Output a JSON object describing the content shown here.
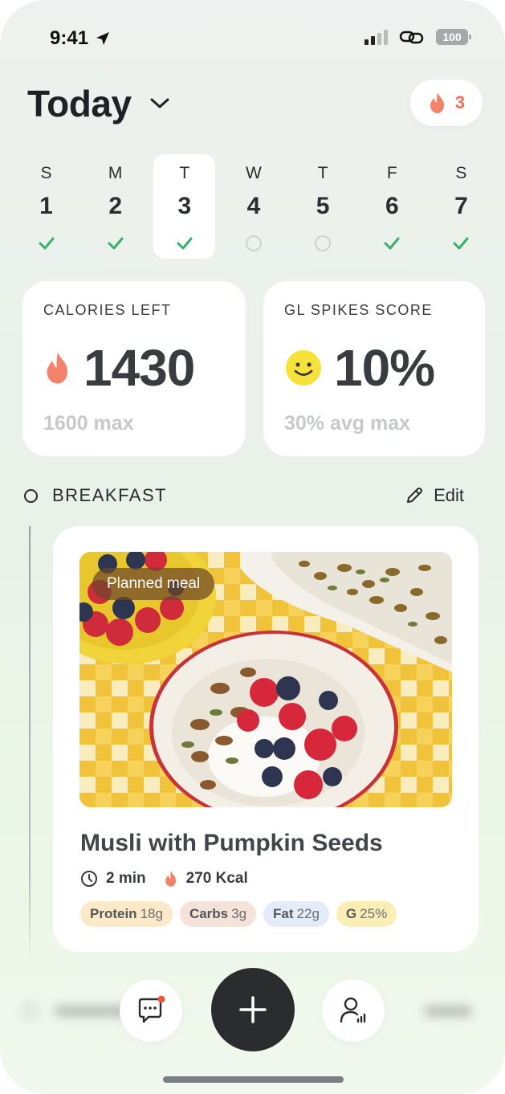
{
  "status_bar": {
    "time": "9:41",
    "battery": "100"
  },
  "header": {
    "title": "Today",
    "streak_count": "3"
  },
  "week": [
    {
      "letter": "S",
      "number": "1",
      "done": true,
      "selected": false
    },
    {
      "letter": "M",
      "number": "2",
      "done": true,
      "selected": false
    },
    {
      "letter": "T",
      "number": "3",
      "done": true,
      "selected": true
    },
    {
      "letter": "W",
      "number": "4",
      "done": false,
      "selected": false
    },
    {
      "letter": "T",
      "number": "5",
      "done": false,
      "selected": false
    },
    {
      "letter": "F",
      "number": "6",
      "done": true,
      "selected": false
    },
    {
      "letter": "S",
      "number": "7",
      "done": true,
      "selected": false
    }
  ],
  "calories": {
    "label": "CALORIES LEFT",
    "value": "1430",
    "max": "1600 max"
  },
  "gl": {
    "label": "GL SPIKES SCORE",
    "value": "10%",
    "max": "30% avg max"
  },
  "breakfast": {
    "label": "BREAKFAST",
    "edit_label": "Edit"
  },
  "meal": {
    "badge": "Planned meal",
    "title": "Musli with Pumpkin Seeds",
    "time": "2 min",
    "kcal": "270 Kcal",
    "chips": [
      {
        "name": "Protein",
        "value": "18g",
        "color": "#fbe9c8"
      },
      {
        "name": "Carbs",
        "value": "3g",
        "color": "#f5e3da"
      },
      {
        "name": "Fat",
        "value": "22g",
        "color": "#e4ecfa"
      },
      {
        "name": "G",
        "value": "25%",
        "color": "#fbeeb5"
      }
    ]
  },
  "colors": {
    "accent_flame": "#f26f55",
    "check": "#33b26a",
    "dark": "#2b2c2e"
  },
  "icons": [
    "location-arrow-icon",
    "signal-icon",
    "link-icon",
    "battery-icon",
    "chevron-down-icon",
    "flame-icon",
    "check-icon",
    "smiley-icon",
    "pencil-icon",
    "clock-icon",
    "chat-icon",
    "plus-icon",
    "profile-stats-icon"
  ]
}
